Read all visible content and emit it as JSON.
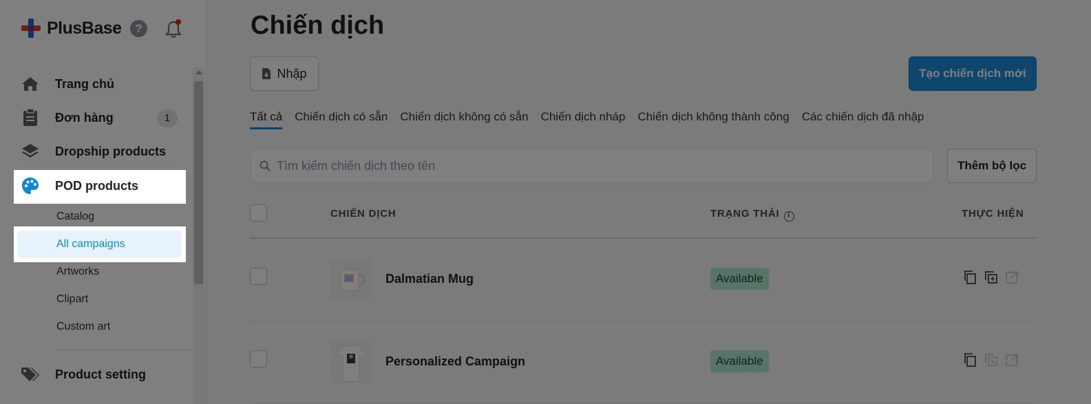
{
  "brand": {
    "name": "PlusBase"
  },
  "sidebar": {
    "items": [
      {
        "label": "Trang chủ",
        "icon": "home-icon"
      },
      {
        "label": "Đơn hàng",
        "icon": "clipboard-icon",
        "badge": "1"
      },
      {
        "label": "Dropship products",
        "icon": "layers-icon"
      },
      {
        "label": "POD products",
        "icon": "palette-icon"
      },
      {
        "label": "Product setting",
        "icon": "tags-icon"
      }
    ],
    "pod_subitems": [
      "Catalog",
      "All campaigns",
      "Artworks",
      "Clipart",
      "Custom art"
    ]
  },
  "page": {
    "title": "Chiến dịch",
    "import_label": "Nhập",
    "create_label": "Tạo chiến dịch mới",
    "tabs": [
      "Tất cả",
      "Chiến dịch có sẵn",
      "Chiến dịch không có sẵn",
      "Chiến dịch nháp",
      "Chiến dịch không thành công",
      "Các chiến dịch đã nhập"
    ],
    "search_placeholder": "Tìm kiếm chiến dịch theo tên",
    "filter_label": "Thêm bộ lọc"
  },
  "table": {
    "headers": {
      "campaign": "CHIẾN DỊCH",
      "status": "TRẠNG THÁI",
      "actions": "THỰC HIỆN"
    },
    "rows": [
      {
        "name": "Dalmatian Mug",
        "status": "Available"
      },
      {
        "name": "Personalized Campaign",
        "status": "Available"
      }
    ]
  },
  "colors": {
    "accent": "#0e88d4",
    "primary_button": "#1c8cdb",
    "status_available_bg": "#aee9d1",
    "brand_red": "#e03c31",
    "brand_blue": "#2d64c8"
  }
}
